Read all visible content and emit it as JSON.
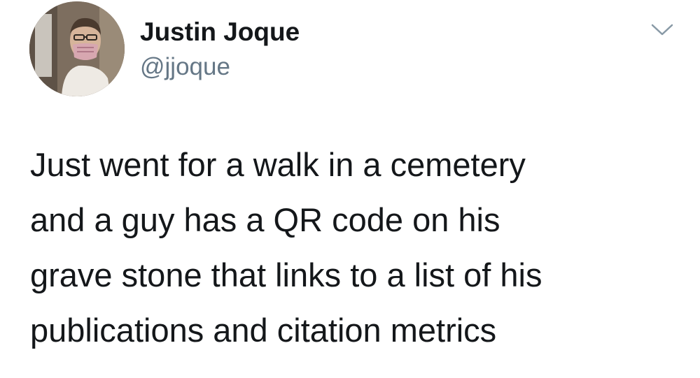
{
  "tweet": {
    "author": {
      "display_name": "Justin Joque",
      "handle": "@jjoque"
    },
    "icons": {
      "avatar": "profile-photo",
      "caret": "chevron-down-icon"
    },
    "text_lines": [
      "Just went for a walk in a cemetery",
      "and a guy has a QR code on his",
      "grave stone that links to a list of his",
      "publications and citation metrics"
    ],
    "colors": {
      "name": "#14171a",
      "handle": "#657786",
      "caret": "#8899a6",
      "background": "#ffffff"
    }
  }
}
